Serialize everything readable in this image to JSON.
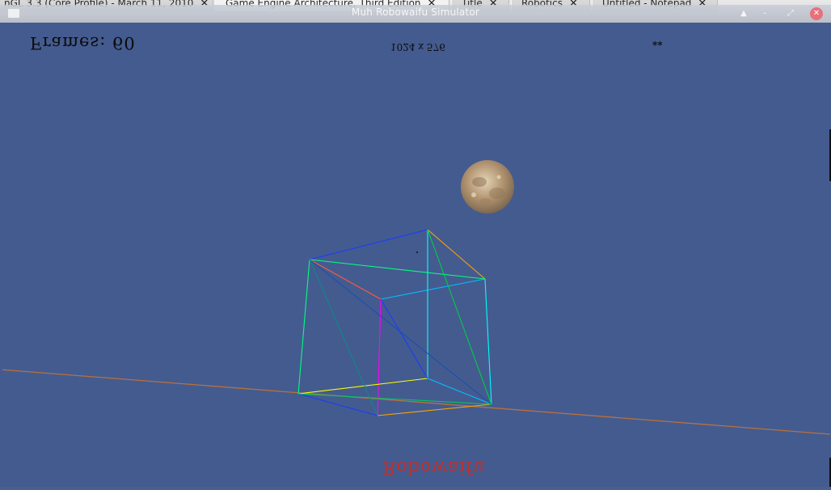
{
  "tabs": [
    {
      "label": "nGL 3.3 (Core Profile) - March 11, 2010",
      "active": false
    },
    {
      "label": "Game Engine Architecture, Third Edition",
      "active": true
    },
    {
      "label": "Title",
      "active": false
    },
    {
      "label": "Robotics",
      "active": false
    },
    {
      "label": "Untitled - Notepad",
      "active": false
    }
  ],
  "window": {
    "title": "Muh Robowaifu Simulator",
    "buttons": {
      "keep_above": "▲",
      "minimize": "–",
      "maximize": "⤢",
      "close": "✕"
    }
  },
  "hud": {
    "frames": "Frames: 60",
    "resolution": "1024 x 576",
    "marker": "**",
    "bottom": "Robowaifu"
  },
  "scene": {
    "background": "#445b8f",
    "moon_colors": [
      "#e4d4b6",
      "#b39572",
      "#7d6850"
    ],
    "ground_line_color": "#b8713f",
    "edge_colors": [
      "#00ffff",
      "#00ff7f",
      "#1a3cff",
      "#ff3a3a",
      "#ffa500",
      "#ff00ff",
      "#ffff00",
      "#0f7f7f"
    ]
  }
}
